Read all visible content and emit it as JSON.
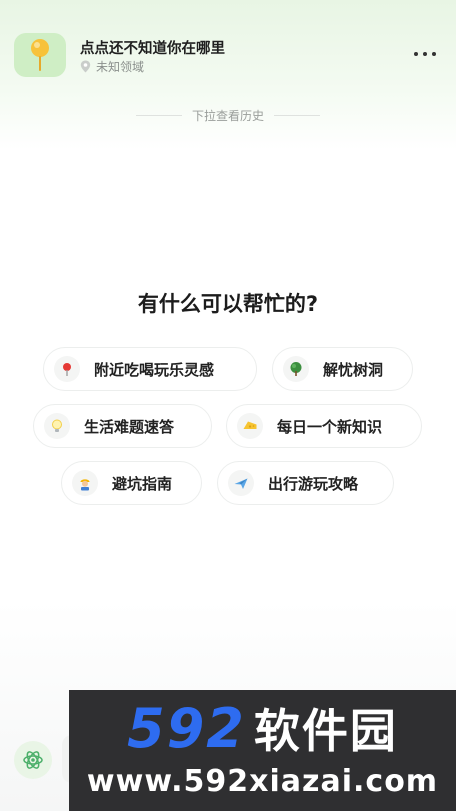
{
  "header": {
    "title": "点点还不知道你在哪里",
    "location": "未知领域",
    "avatar_icon": "balloon-pin-icon",
    "more_icon": "more-icon"
  },
  "history_hint": "下拉查看历史",
  "main": {
    "heading": "有什么可以帮忙的?",
    "suggestions": [
      {
        "label": "附近吃喝玩乐灵感",
        "icon": "pin-icon"
      },
      {
        "label": "解忧树洞",
        "icon": "tree-icon"
      },
      {
        "label": "生活难题速答",
        "icon": "lightbulb-icon"
      },
      {
        "label": "每日一个新知识",
        "icon": "cheese-icon"
      },
      {
        "label": "避坑指南",
        "icon": "worker-icon"
      },
      {
        "label": "出行游玩攻略",
        "icon": "airplane-icon"
      }
    ]
  },
  "bottom": {
    "icon": "atom-icon"
  },
  "watermark": {
    "brand_number": "592",
    "brand_cn": "软件园",
    "url": "www.592xiazai.com"
  },
  "colors": {
    "accent_green": "#cfeec5",
    "brand_blue": "#2e6cf0",
    "watermark_bg": "#2f2f31"
  }
}
